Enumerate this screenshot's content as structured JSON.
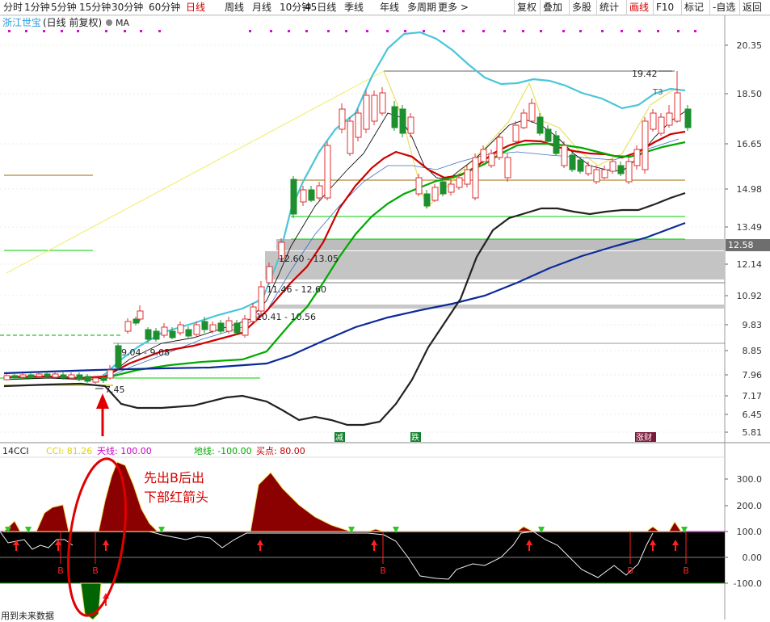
{
  "toolbar": {
    "tabs": [
      "分时",
      "1分钟",
      "5分钟",
      "15分钟",
      "30分钟",
      "60分钟",
      "日线",
      "周线",
      "月线",
      "10分钟",
      "45日线",
      "季线",
      "年线",
      "多周期",
      "更多 >"
    ],
    "active_tab": "日线",
    "buttons": [
      "复权",
      "叠加",
      "多股",
      "统计",
      "画线",
      "F10",
      "标记",
      "-自选",
      "返回"
    ],
    "active_button": "画线"
  },
  "stock": {
    "name": "浙江世宝",
    "mode": "(日线 前复权)",
    "indicator": "MA"
  },
  "price_axis": {
    "ticks": [
      "20.35",
      "18.50",
      "16.65",
      "14.98",
      "13.49",
      "12.14",
      "10.92",
      "9.83",
      "8.85",
      "7.96",
      "7.17",
      "6.45",
      "5.81"
    ],
    "current_price": "12.58"
  },
  "annotations": {
    "peak_label": "19.42",
    "peak_sub": "T3",
    "low_label": "7.45",
    "zones": [
      "9.04 - 9.08",
      "10.41 - 10.56",
      "11.46 - 12.60",
      "12.60 - 13.05"
    ],
    "markers": [
      "减",
      "跌",
      "涨财"
    ]
  },
  "cci_panel": {
    "title": "14CCI",
    "cci_label": "CCI: 81.26",
    "tianxian_label": "天线: 100.00",
    "dixian_label": "地线: -100.00",
    "maidian_label": "买点: 80.00",
    "ticks": [
      "300.0",
      "200.0",
      "100.0",
      "0.00",
      "-100.0"
    ],
    "buy_signal": "B",
    "callout": [
      "先出B后出",
      "下部红箭头"
    ]
  },
  "footer": "用到未来数据",
  "colors": {
    "up": "#e03030",
    "down": "#1e8f2e",
    "ma5": "#000000",
    "ma10": "#cc0000",
    "ma20": "#00aa00",
    "ma60": "#0b2a9a",
    "boll_upper": "#49c6d8",
    "cci_fill": "#8b0000",
    "cci_neg_fill": "#006400",
    "signal_red": "#e00000"
  }
}
